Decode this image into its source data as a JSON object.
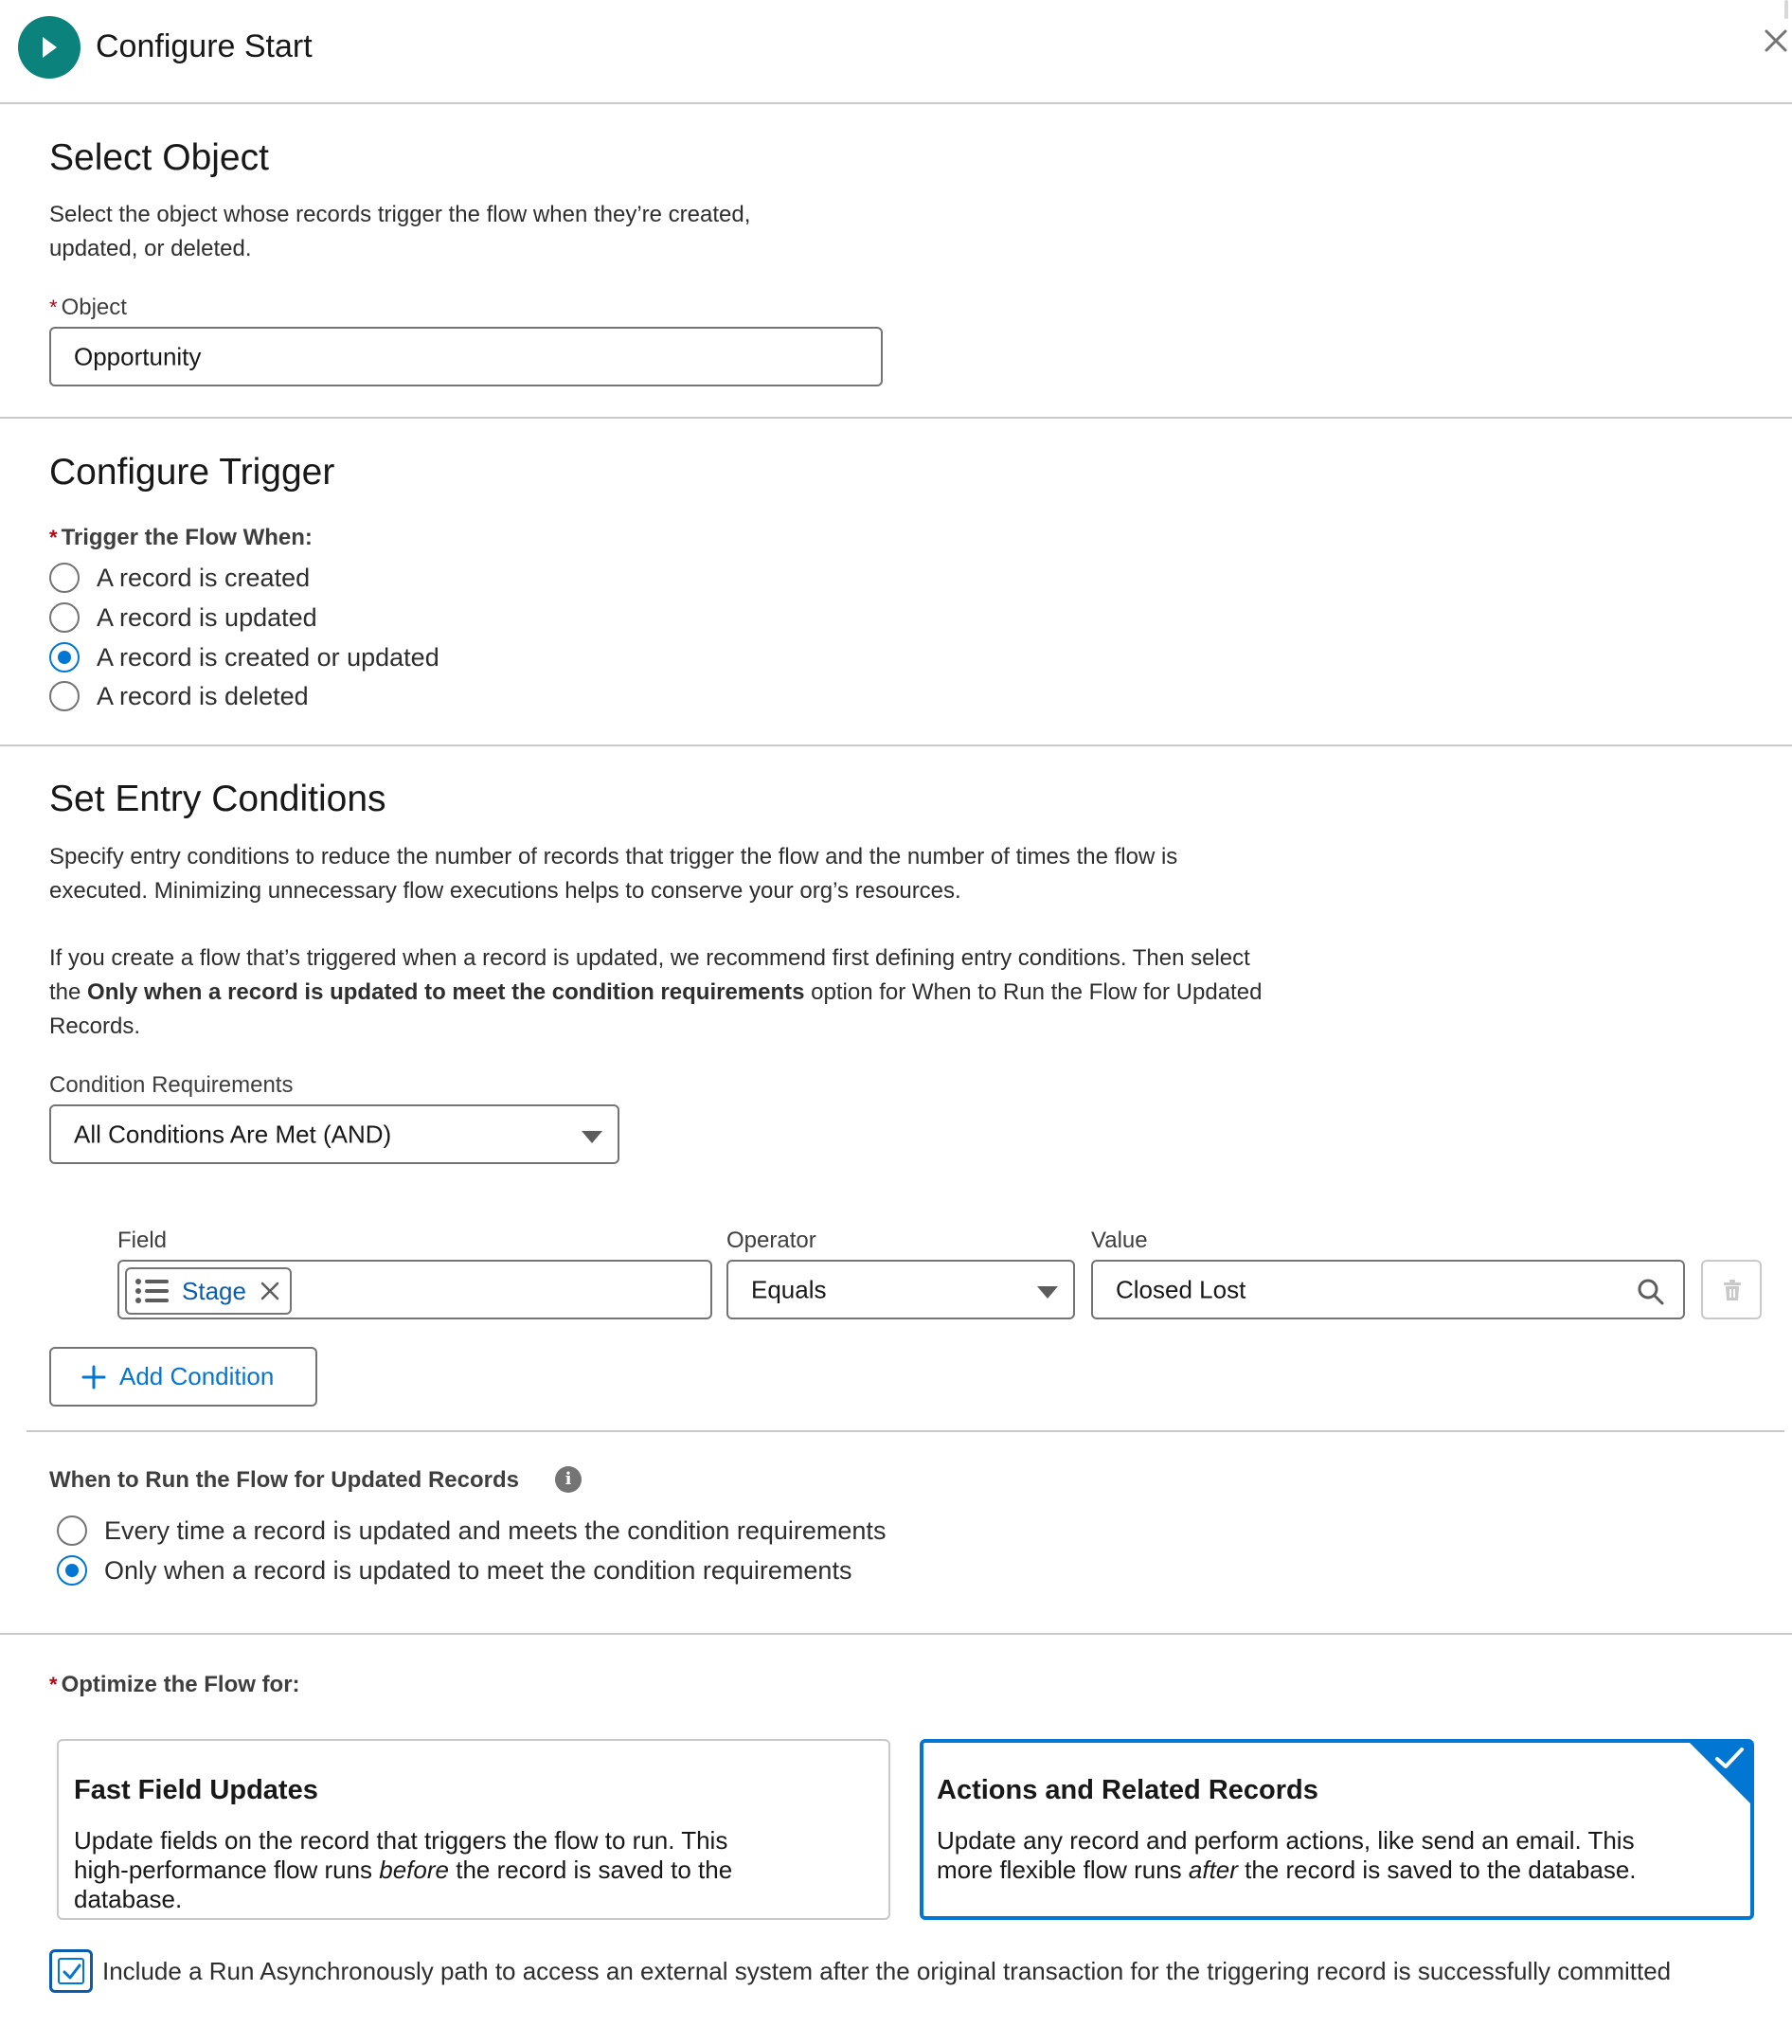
{
  "header": {
    "title": "Configure Start"
  },
  "select_object": {
    "title": "Select Object",
    "description_line1": "Select the object whose records trigger the flow when they’re created,",
    "description_line2": "updated, or deleted.",
    "object_label": "Object",
    "object_value": "Opportunity"
  },
  "configure_trigger": {
    "title": "Configure Trigger",
    "label": "Trigger the Flow When:",
    "options": [
      {
        "label": "A record is created",
        "checked": false
      },
      {
        "label": "A record is updated",
        "checked": false
      },
      {
        "label": "A record is created or updated",
        "checked": true
      },
      {
        "label": "A record is deleted",
        "checked": false
      }
    ]
  },
  "entry_conditions": {
    "title": "Set Entry Conditions",
    "para1_line1": "Specify entry conditions to reduce the number of records that trigger the flow and the number of times the flow is",
    "para1_line2": "executed. Minimizing unnecessary flow executions helps to conserve your org’s resources.",
    "para2_line1": "If you create a flow that’s triggered when a record is updated, we recommend first defining entry conditions. Then select",
    "para2_line2_prefix": "the ",
    "para2_line2_bold": "Only when a record is updated to meet the condition requirements",
    "para2_line2_suffix": " option for When to Run the Flow for Updated",
    "para2_line3": "Records.",
    "requirements_label": "Condition Requirements",
    "requirements_value": "All Conditions Are Met (AND)",
    "condition": {
      "field_label": "Field",
      "field_value": "Stage",
      "operator_label": "Operator",
      "operator_value": "Equals",
      "value_label": "Value",
      "value_value": "Closed Lost"
    },
    "add_condition_label": "Add Condition"
  },
  "when_to_run": {
    "label": "When to Run the Flow for Updated Records",
    "info_glyph": "i",
    "options": [
      {
        "label": "Every time a record is updated and meets the condition requirements",
        "checked": false
      },
      {
        "label": "Only when a record is updated to meet the condition requirements",
        "checked": true
      }
    ]
  },
  "optimize": {
    "label": "Optimize the Flow for:",
    "cards": [
      {
        "title": "Fast Field Updates",
        "desc_line1": "Update fields on the record that triggers the flow to run. This",
        "desc_line2_prefix": "high-performance flow runs ",
        "desc_line2_em": "before",
        "desc_line2_suffix": " the record is saved to the",
        "desc_line3": "database.",
        "selected": false
      },
      {
        "title": "Actions and Related Records",
        "desc_line1": "Update any record and perform actions, like send an email. This",
        "desc_line2_prefix": "more flexible flow runs ",
        "desc_line2_em": "after",
        "desc_line2_suffix": " the record is saved to the database.",
        "selected": true
      }
    ],
    "async_checkbox_label": "Include a Run Asynchronously path to access an external system after the original transaction for the triggering record is successfully committed",
    "async_checked": true
  },
  "colors": {
    "accent": "#0176d3",
    "start_icon": "#0b827c",
    "required": "#ba0517"
  }
}
